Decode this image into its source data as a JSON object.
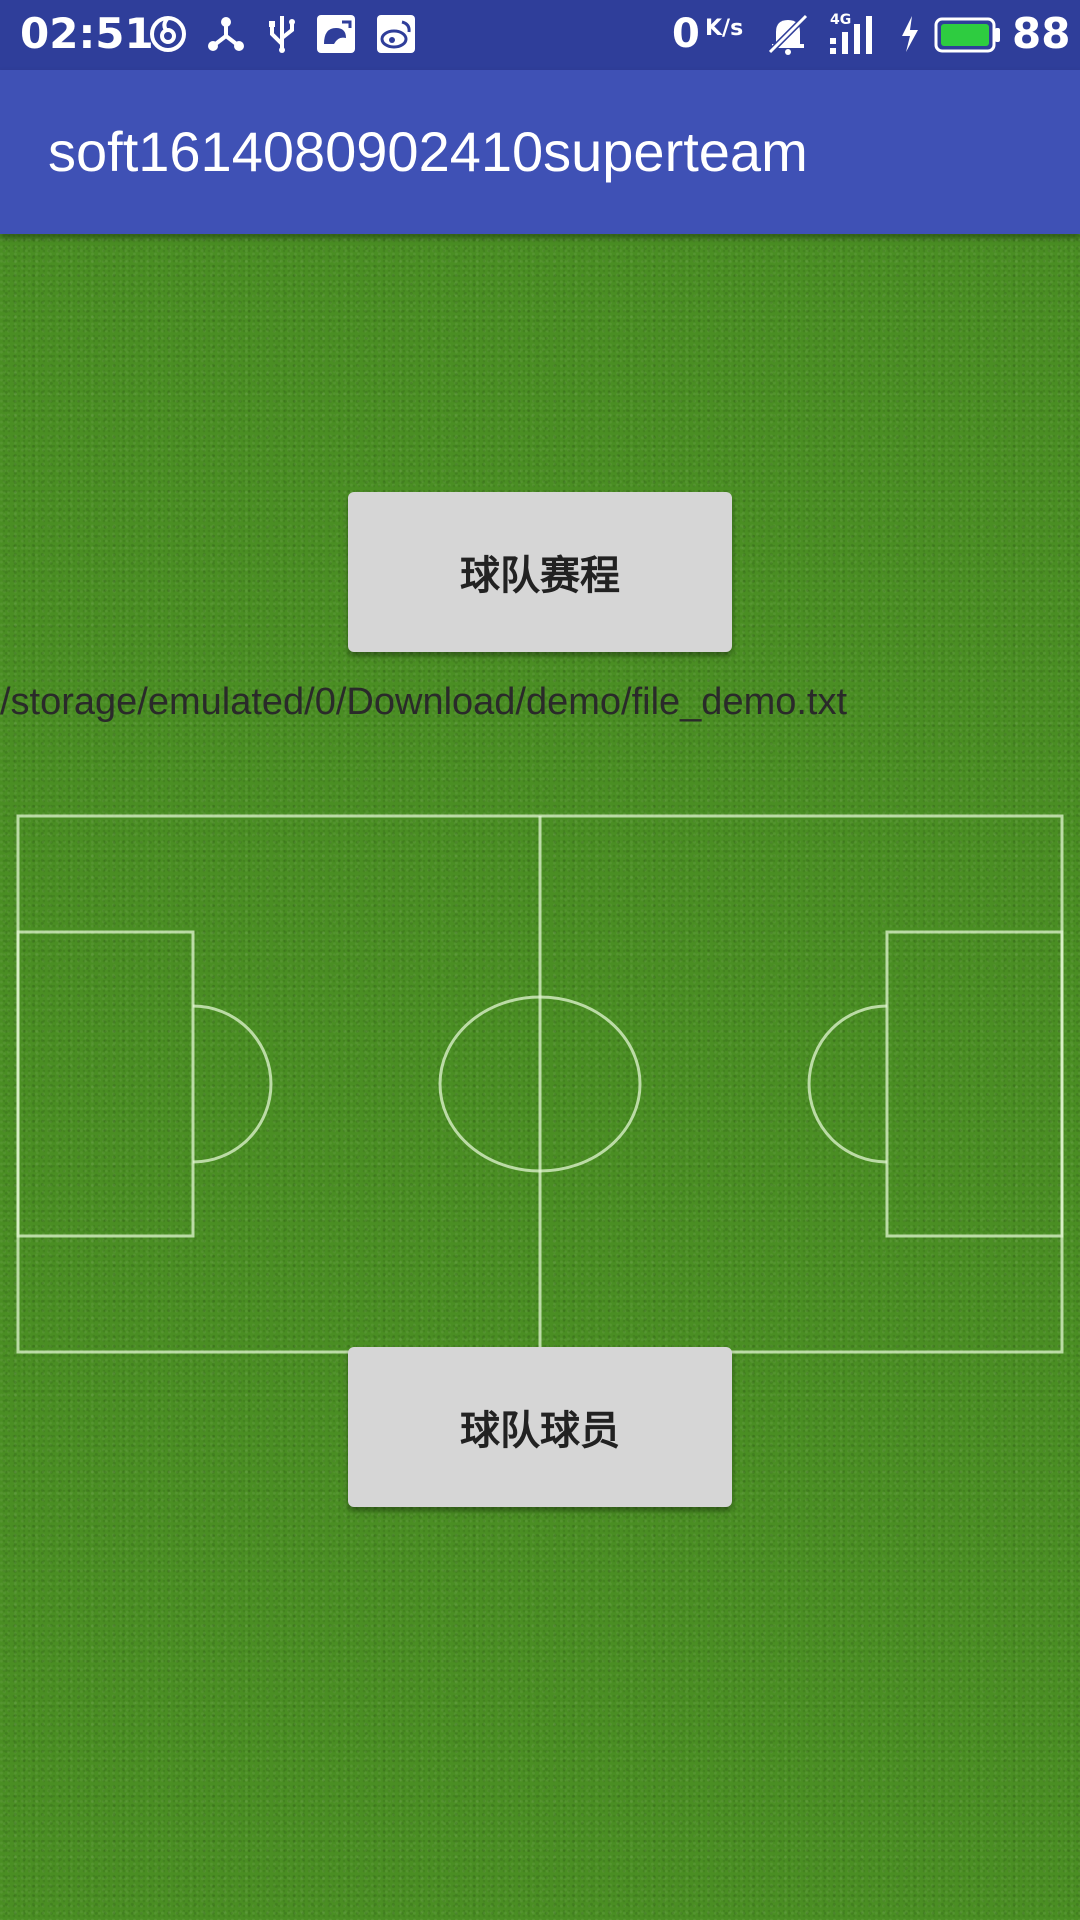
{
  "status_bar": {
    "time": "02:51",
    "net_speed": "0",
    "net_speed_unit": "K/s",
    "network_type": "4G",
    "battery_level": "88",
    "icons": [
      "netease-music-icon",
      "share-hub-icon",
      "usb-icon",
      "uc-browser-icon",
      "weibo-icon",
      "mute-bell-icon",
      "signal-icon",
      "charging-icon",
      "battery-icon"
    ],
    "battery_color": "#2ecc40"
  },
  "app_bar": {
    "title": "soft1614080902410superteam",
    "color": "#3f51b5"
  },
  "main": {
    "schedule_button_label": "球队赛程",
    "file_path": "/storage/emulated/0/Download/demo/file_demo.txt",
    "players_button_label": "球队球员",
    "background_color": "#4a8e23"
  }
}
